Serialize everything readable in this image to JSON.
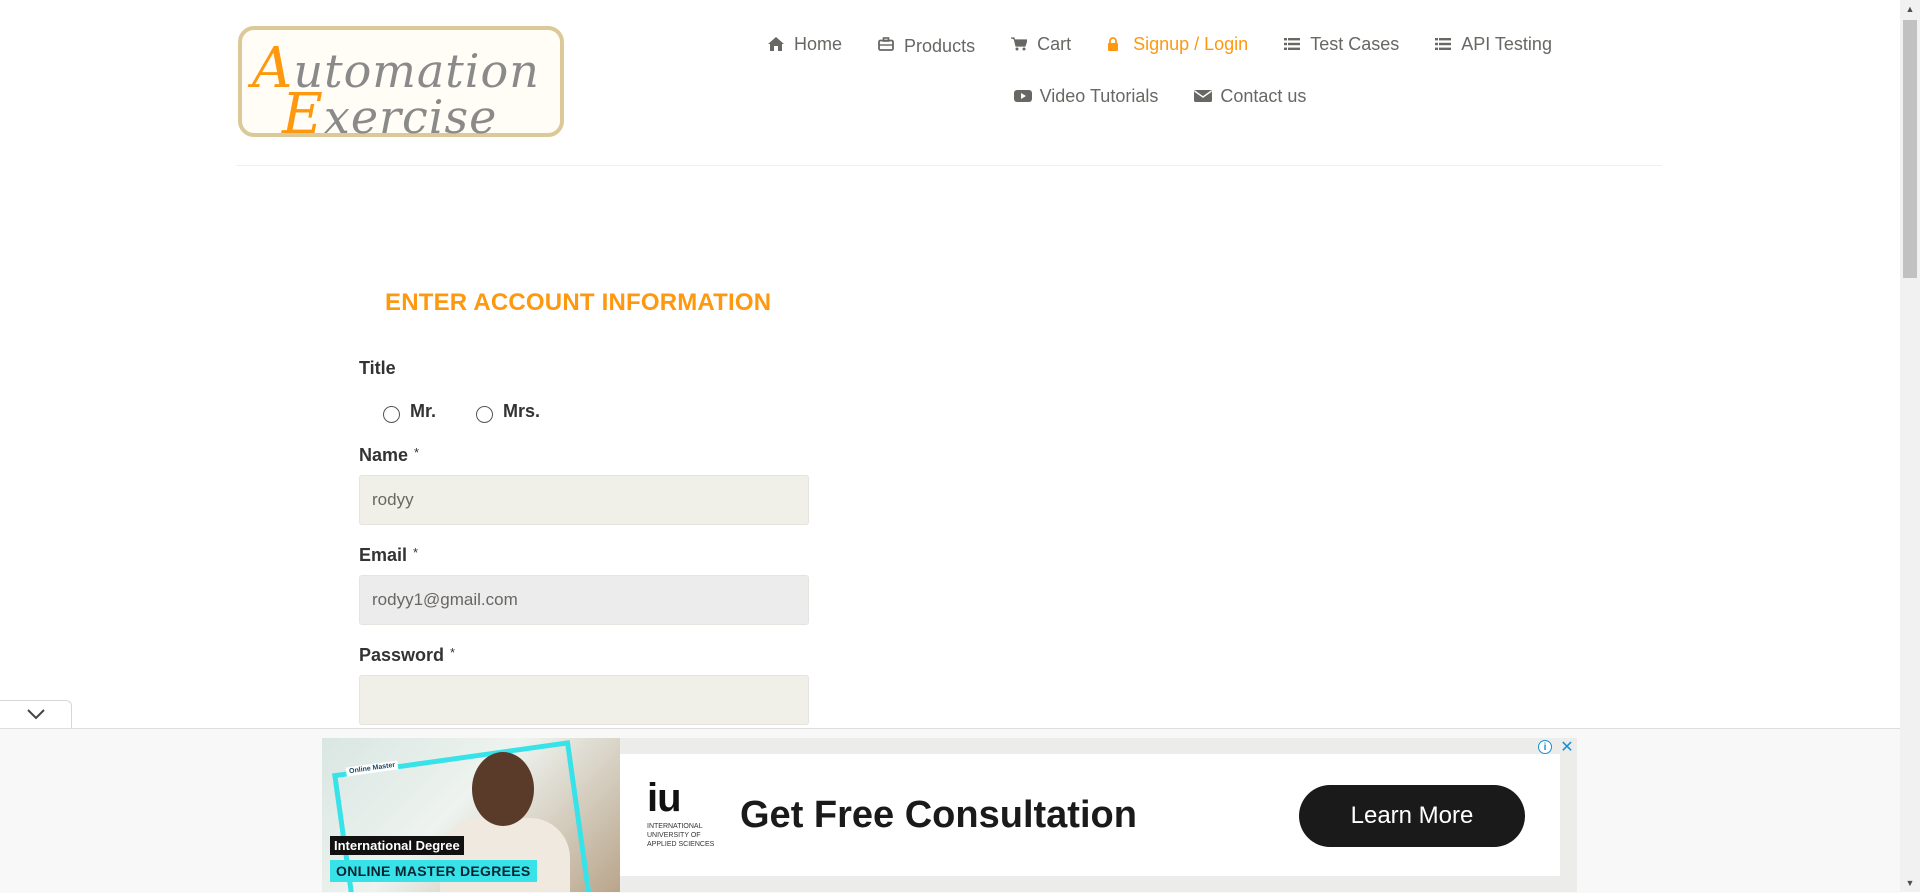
{
  "logo": {
    "line1_initial": "A",
    "line1_rest": "utomation",
    "line2_initial": "E",
    "line2_rest": "xercise"
  },
  "nav": {
    "items": [
      {
        "label": "Home",
        "icon": "home-icon"
      },
      {
        "label": "Products",
        "icon": "briefcase-icon"
      },
      {
        "label": "Cart",
        "icon": "cart-icon"
      },
      {
        "label": "Signup / Login",
        "icon": "lock-icon",
        "active": true
      },
      {
        "label": "Test Cases",
        "icon": "list-icon"
      },
      {
        "label": "API Testing",
        "icon": "list-icon"
      },
      {
        "label": "Video Tutorials",
        "icon": "youtube-icon"
      },
      {
        "label": "Contact us",
        "icon": "envelope-icon"
      }
    ]
  },
  "form": {
    "heading": "ENTER ACCOUNT INFORMATION",
    "title_label": "Title",
    "title_options": [
      "Mr.",
      "Mrs."
    ],
    "name_label": "Name",
    "name_value": "rodyy",
    "email_label": "Email",
    "email_value": "rodyy1@gmail.com",
    "password_label": "Password",
    "password_value": "",
    "required_mark": "*"
  },
  "ad": {
    "photo_tag_small": "Online Master",
    "photo_tag_degree": "International Degree",
    "photo_tag_program": "ONLINE MASTER DEGREES",
    "brand_short": "iu",
    "brand_full": "INTERNATIONAL UNIVERSITY OF APPLIED SCIENCES",
    "headline": "Get Free Consultation",
    "cta": "Learn More"
  },
  "colors": {
    "accent": "#fe980f",
    "text": "#696763",
    "input_bg": "#f0f0e9",
    "ad_cta": "#1a1a1a",
    "ad_cyan": "#37e3e8"
  }
}
